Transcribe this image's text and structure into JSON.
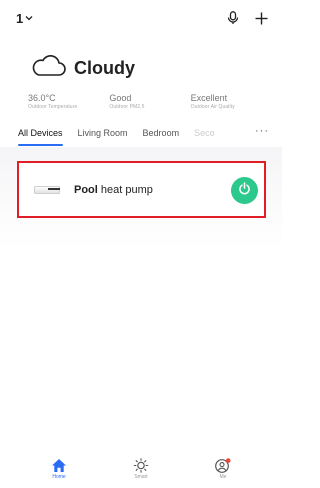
{
  "header": {
    "home_name": "1",
    "icons": [
      "chevron-down-icon",
      "microphone-icon",
      "plus-icon"
    ]
  },
  "weather": {
    "condition": "Cloudy",
    "icon": "cloud-icon"
  },
  "stats": [
    {
      "value": "36.0°C",
      "label": "Outdoor Temperature"
    },
    {
      "value": "Good",
      "label": "Outdoor PM2.5"
    },
    {
      "value": "Excellent",
      "label": "Outdoor Air Quality"
    }
  ],
  "tabs": {
    "items": [
      "All Devices",
      "Living Room",
      "Bedroom",
      "Seco"
    ],
    "active": "All Devices",
    "more": "···"
  },
  "device": {
    "name_bold": "Pool",
    "name_rest": " heat pump",
    "power_icon": "power-icon",
    "power_color": "#2dc88c",
    "highlight_color": "#e11d26"
  },
  "bottom_nav": [
    {
      "label": "Home",
      "icon": "home-icon",
      "active": true
    },
    {
      "label": "Smart",
      "icon": "sun-icon",
      "active": false
    },
    {
      "label": "Me",
      "icon": "profile-icon",
      "active": false
    }
  ],
  "colors": {
    "accent": "#2a6df4",
    "notification_dot": "#f04438"
  }
}
